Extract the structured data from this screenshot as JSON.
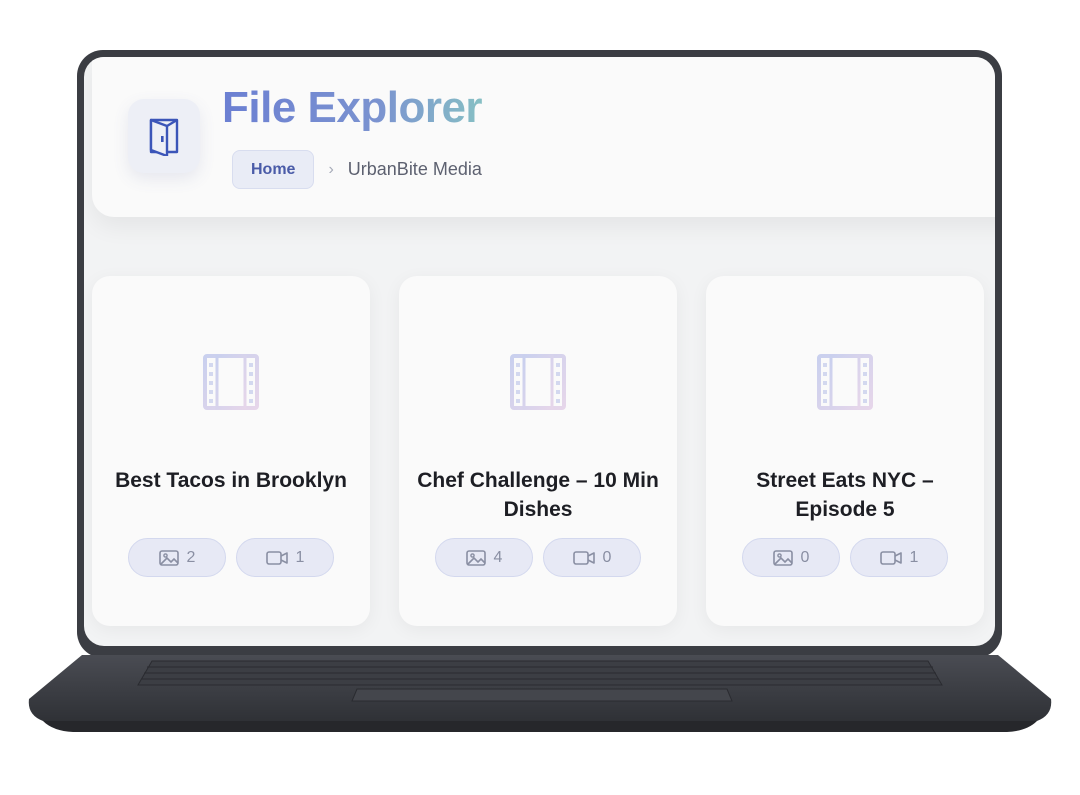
{
  "app": {
    "title": "File Explorer",
    "accent": "#6b7fd2"
  },
  "breadcrumb": {
    "home": "Home",
    "separator": "›",
    "current": "UrbanBite Media"
  },
  "folders": [
    {
      "name": "Best Tacos in Brooklyn",
      "images": "2",
      "videos": "1"
    },
    {
      "name": "Chef Challenge – 10 Min Dishes",
      "images": "4",
      "videos": "0"
    },
    {
      "name": "Street Eats NYC – Episode 5",
      "images": "0",
      "videos": "1"
    }
  ],
  "icons": {
    "app": "folder-door-icon",
    "folder_thumb": "film-icon",
    "images": "image-icon",
    "videos": "video-icon"
  }
}
